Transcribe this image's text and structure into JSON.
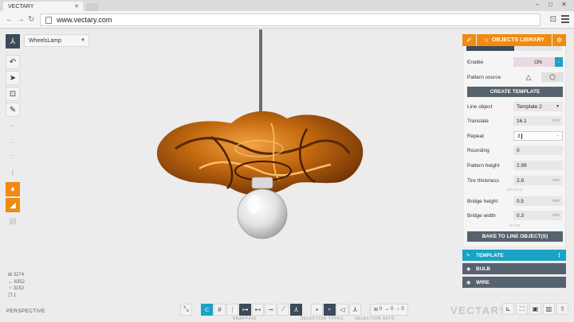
{
  "browser": {
    "tab_title": "VECTARY",
    "url": "www.vectary.com",
    "minimize": "–",
    "maximize": "□",
    "close": "✕"
  },
  "scene": {
    "name": "WheelsLamp",
    "view_mode": "PERSPECTIVE",
    "stats": {
      "faces": "3274",
      "edges": "6352",
      "vertices": "3152",
      "objects": "1"
    }
  },
  "bottom_toolbar": {
    "snapping_label": "SNAPPING",
    "selection_types_label": "SELECTION TYPES",
    "selection_sets_label": "SELECTION SETS",
    "sets_faces": "0",
    "sets_edges": "0",
    "sets_vertices": "0"
  },
  "logo_text": "VECTARY",
  "panel": {
    "library_label": "OBJECTS LIBRARY",
    "enable_label": "Enable",
    "enable_state": "ON",
    "pattern_source_label": "Pattern source",
    "create_template_label": "CREATE TEMPLATE",
    "line_object_label": "Line object",
    "line_object_value": "Template 2",
    "translate_label": "Translate",
    "translate_value": "16.1",
    "translate_unit": "mm",
    "repeat_label": "Repeat",
    "repeat_value": "3",
    "rounding_label": "Rounding",
    "rounding_value": "0",
    "pattern_height_label": "Pattern height",
    "pattern_height_value": "2.99",
    "tire_thickness_label": "Tire thickness",
    "tire_thickness_value": "2.9",
    "tire_thickness_unit": "mm",
    "bridge_section": "BRIDGE",
    "bridge_height_label": "Bridge height",
    "bridge_height_value": "0.5",
    "bridge_height_unit": "mm",
    "bridge_width_label": "Bridge width",
    "bridge_width_value": "0.3",
    "bridge_width_unit": "mm",
    "bake_section": "BAKE",
    "bake_label": "BAKE TO LINE OBJECT(S)"
  },
  "layers": [
    {
      "label": "TEMPLATE",
      "active": true
    },
    {
      "label": "BULB",
      "active": false
    },
    {
      "label": "WIRE",
      "active": false
    }
  ],
  "colors": {
    "accent_orange": "#f08a10",
    "accent_blue": "#1aa3c4",
    "panel_dark": "#56636e",
    "lamp_copper": "#b8600c"
  }
}
